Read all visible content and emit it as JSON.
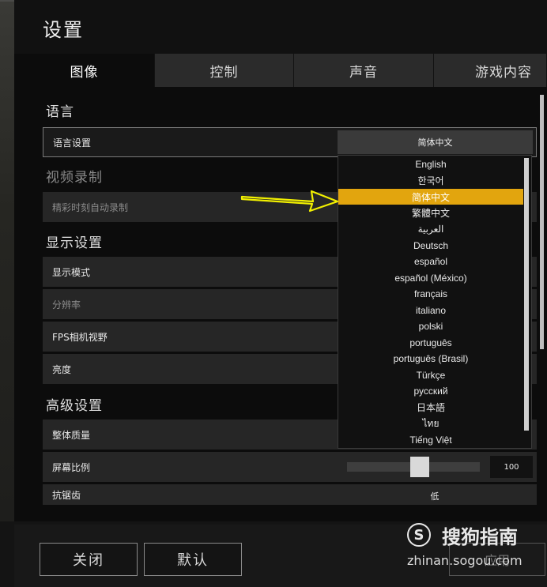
{
  "title": "设置",
  "tabs": [
    {
      "label": "图像",
      "active": true
    },
    {
      "label": "控制",
      "active": false
    },
    {
      "label": "声音",
      "active": false
    },
    {
      "label": "游戏内容",
      "active": false
    }
  ],
  "sections": {
    "language": "语言",
    "video_record": "视频录制",
    "display": "显示设置",
    "advanced": "高级设置"
  },
  "rows": {
    "language_setting": "语言设置",
    "auto_record": "精彩时刻自动录制",
    "display_mode": "显示模式",
    "resolution": "分辨率",
    "fps_fov": "FPS相机视野",
    "brightness": "亮度",
    "overall_quality": "整体质量",
    "screen_scale": "屏幕比例",
    "antialiasing": "抗锯齿"
  },
  "language_select": {
    "value": "简体中文",
    "options": [
      "English",
      "한국어",
      "简体中文",
      "繁體中文",
      "العربية",
      "Deutsch",
      "español",
      "español (México)",
      "français",
      "italiano",
      "polski",
      "português",
      "português (Brasil)",
      "Türkçe",
      "русский",
      "日本語",
      "ไทย",
      "Tiếng Việt"
    ],
    "selected_index": 2
  },
  "screen_scale_value": "100",
  "screen_scale_fraction": 0.55,
  "antialiasing_value": "低",
  "footer": {
    "close": "关闭",
    "default": "默认",
    "apply": "应用"
  },
  "watermark": {
    "logo": "S",
    "brand": "搜狗指南",
    "url": "zhinan.sogou.com"
  },
  "colors": {
    "accent": "#e2a50e",
    "arrow": "#f2f000"
  }
}
